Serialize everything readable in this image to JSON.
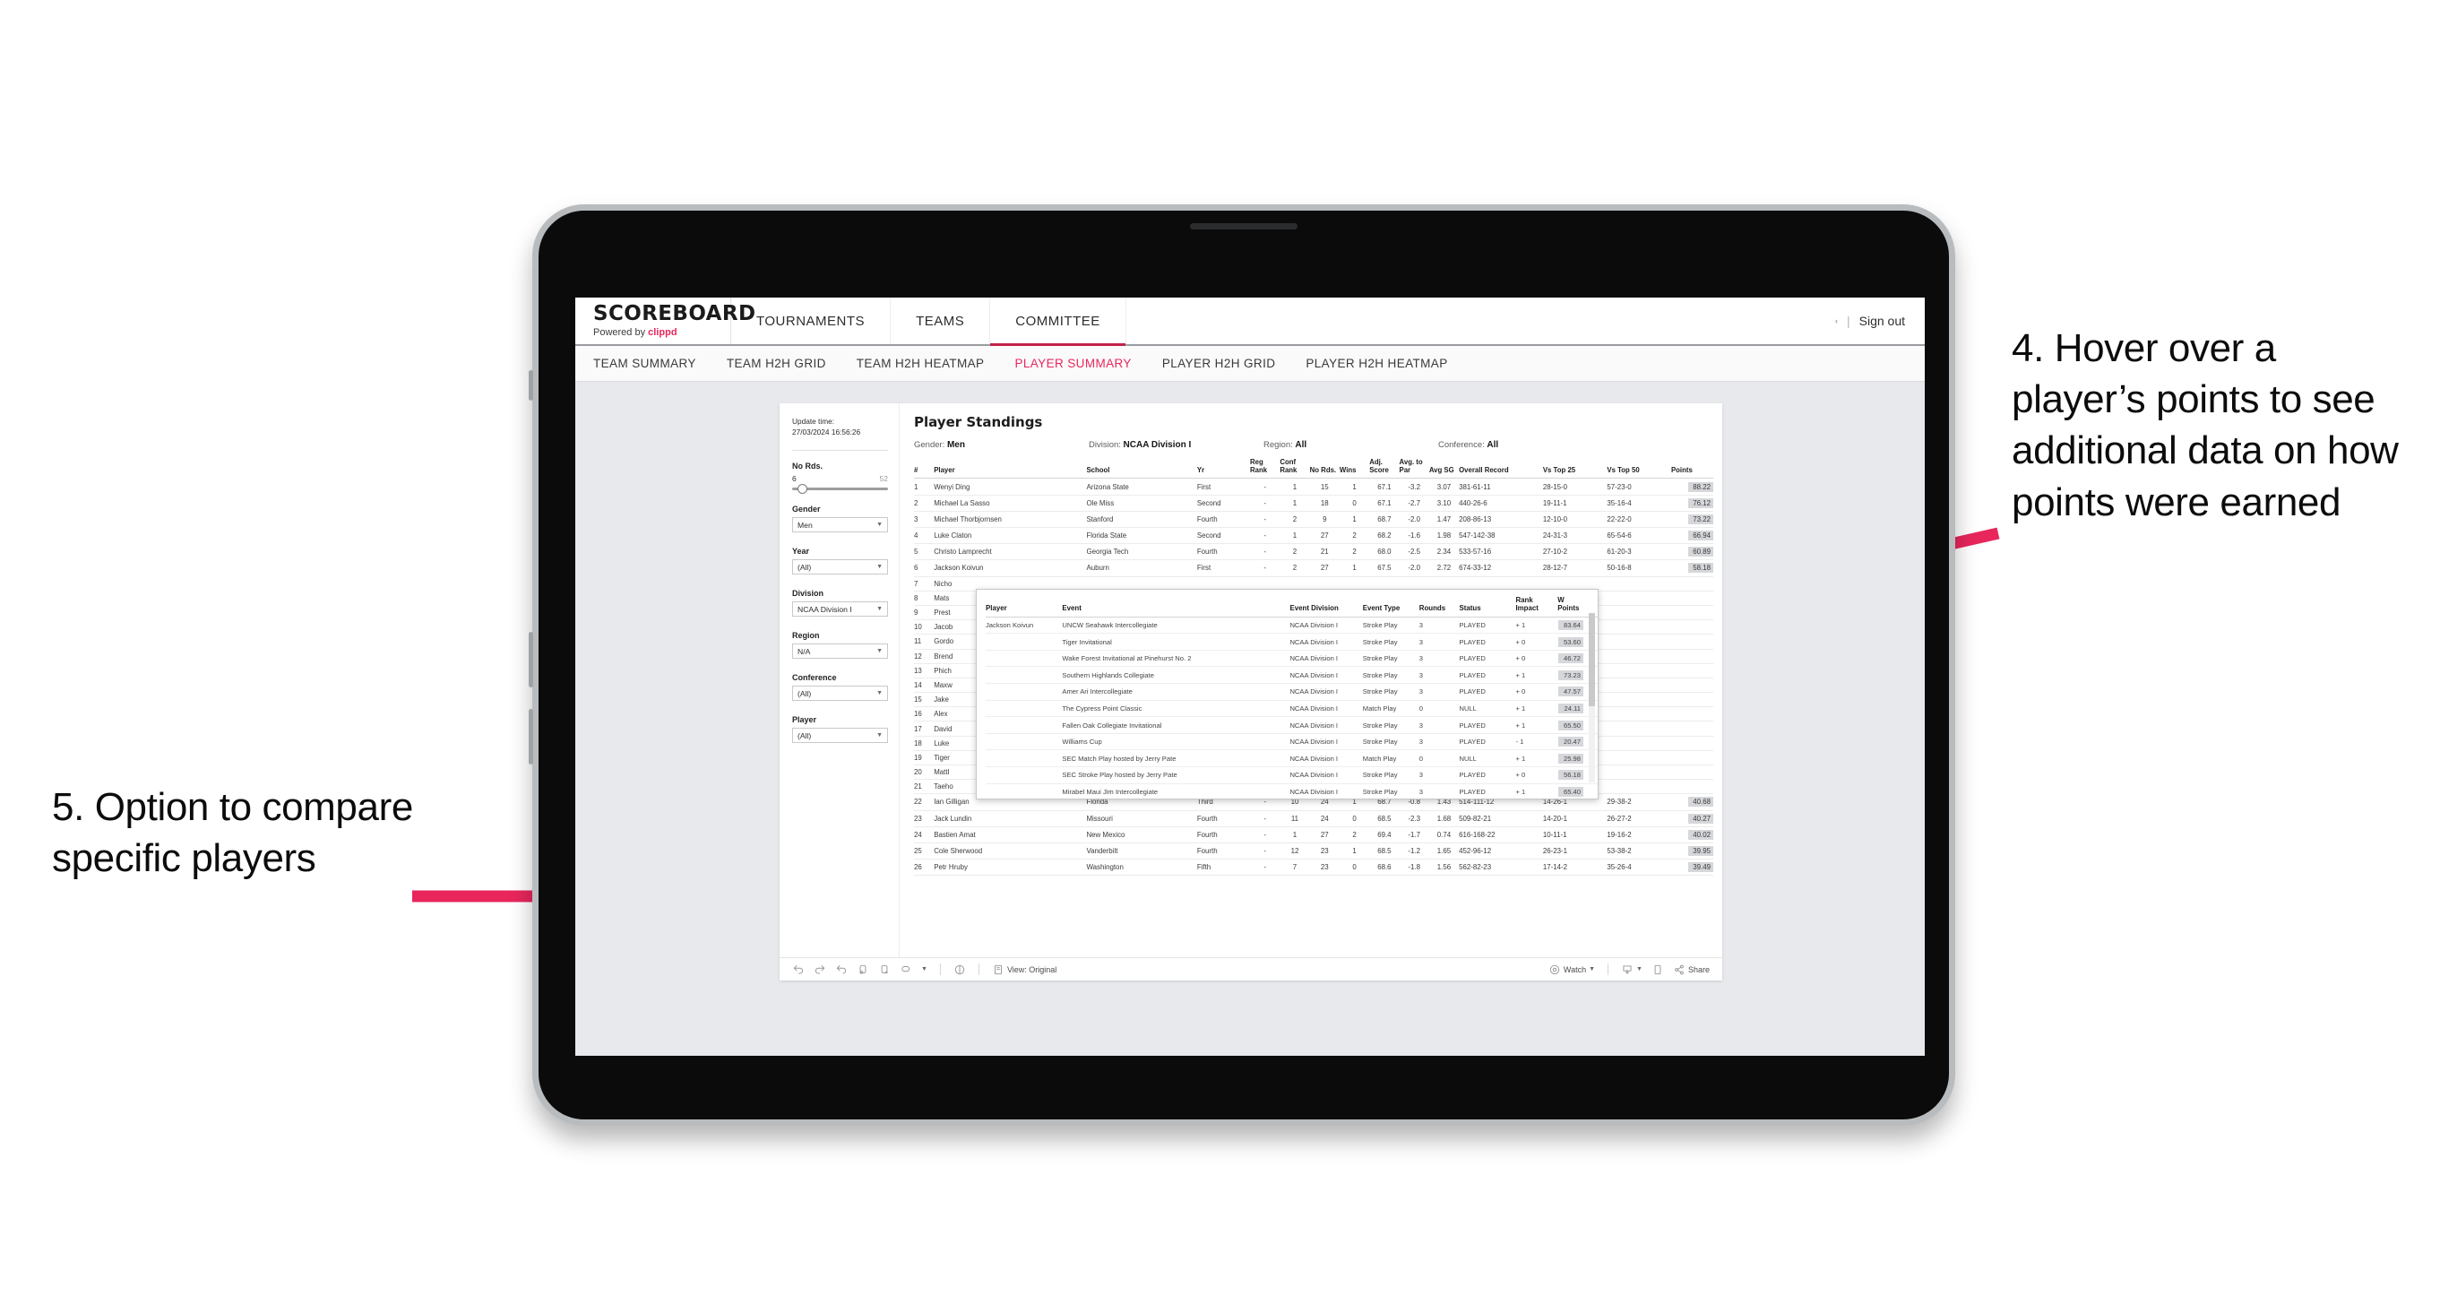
{
  "annotations": {
    "left": "5. Option to compare specific players",
    "right": "4. Hover over a player’s points to see additional data on how points were earned",
    "arrow_color": "#e8265c"
  },
  "app": {
    "brand_title": "SCOREBOARD",
    "brand_sub_prefix": "Powered by ",
    "brand_sub_accent": "clippd",
    "accent_color": "#e8265c",
    "top_nav": [
      {
        "label": "TOURNAMENTS",
        "active": false
      },
      {
        "label": "TEAMS",
        "active": false
      },
      {
        "label": "COMMITTEE",
        "active": true
      }
    ],
    "top_right": {
      "caret": "‹",
      "separator": "|",
      "sign_out": "Sign out"
    },
    "sub_nav": [
      {
        "label": "TEAM SUMMARY",
        "active": false
      },
      {
        "label": "TEAM H2H GRID",
        "active": false
      },
      {
        "label": "TEAM H2H HEATMAP",
        "active": false
      },
      {
        "label": "PLAYER SUMMARY",
        "active": true
      },
      {
        "label": "PLAYER H2H GRID",
        "active": false
      },
      {
        "label": "PLAYER H2H HEATMAP",
        "active": false
      }
    ]
  },
  "rail": {
    "update_label": "Update time:",
    "update_value": "27/03/2024 16:56:26",
    "slider": {
      "label": "No Rds.",
      "min": "6",
      "max": "52"
    },
    "filters": [
      {
        "label": "Gender",
        "value": "Men"
      },
      {
        "label": "Year",
        "value": "(All)"
      },
      {
        "label": "Division",
        "value": "NCAA Division I"
      },
      {
        "label": "Region",
        "value": "N/A"
      },
      {
        "label": "Conference",
        "value": "(All)"
      },
      {
        "label": "Player",
        "value": "(All)"
      }
    ]
  },
  "main": {
    "title": "Player Standings",
    "meta": [
      {
        "label": "Gender:",
        "value": "Men"
      },
      {
        "label": "Division:",
        "value": "NCAA Division I"
      },
      {
        "label": "Region:",
        "value": "All"
      },
      {
        "label": "Conference:",
        "value": "All"
      }
    ],
    "columns": [
      "#",
      "Player",
      "School",
      "Yr",
      "Reg Rank",
      "Conf Rank",
      "No Rds.",
      "Wins",
      "Adj. Score",
      "Avg. to Par",
      "Avg SG",
      "Overall Record",
      "Vs Top 25",
      "Vs Top 50",
      "Points"
    ],
    "rows": [
      {
        "rank": "1",
        "player": "Wenyi Ding",
        "school": "Arizona State",
        "yr": "First",
        "reg": "-",
        "conf": "1",
        "rds": "15",
        "wins": "1",
        "adj": "67.1",
        "par": "-3.2",
        "sg": "3.07",
        "rec": "381-61-11",
        "t25": "28-15-0",
        "t50": "57-23-0",
        "pts": "88.22"
      },
      {
        "rank": "2",
        "player": "Michael La Sasso",
        "school": "Ole Miss",
        "yr": "Second",
        "reg": "-",
        "conf": "1",
        "rds": "18",
        "wins": "0",
        "adj": "67.1",
        "par": "-2.7",
        "sg": "3.10",
        "rec": "440-26-6",
        "t25": "19-11-1",
        "t50": "35-16-4",
        "pts": "76.12"
      },
      {
        "rank": "3",
        "player": "Michael Thorbjornsen",
        "school": "Stanford",
        "yr": "Fourth",
        "reg": "-",
        "conf": "2",
        "rds": "9",
        "wins": "1",
        "adj": "68.7",
        "par": "-2.0",
        "sg": "1.47",
        "rec": "208-86-13",
        "t25": "12-10-0",
        "t50": "22-22-0",
        "pts": "73.22"
      },
      {
        "rank": "4",
        "player": "Luke Claton",
        "school": "Florida State",
        "yr": "Second",
        "reg": "-",
        "conf": "1",
        "rds": "27",
        "wins": "2",
        "adj": "68.2",
        "par": "-1.6",
        "sg": "1.98",
        "rec": "547-142-38",
        "t25": "24-31-3",
        "t50": "65-54-6",
        "pts": "66.94"
      },
      {
        "rank": "5",
        "player": "Christo Lamprecht",
        "school": "Georgia Tech",
        "yr": "Fourth",
        "reg": "-",
        "conf": "2",
        "rds": "21",
        "wins": "2",
        "adj": "68.0",
        "par": "-2.5",
        "sg": "2.34",
        "rec": "533-57-16",
        "t25": "27-10-2",
        "t50": "61-20-3",
        "pts": "60.89"
      },
      {
        "rank": "6",
        "player": "Jackson Koivun",
        "school": "Auburn",
        "yr": "First",
        "reg": "-",
        "conf": "2",
        "rds": "27",
        "wins": "1",
        "adj": "67.5",
        "par": "-2.0",
        "sg": "2.72",
        "rec": "674-33-12",
        "t25": "28-12-7",
        "t50": "50-16-8",
        "pts": "58.18"
      },
      {
        "rank": "7",
        "player": "Nicho",
        "school": "",
        "yr": "",
        "reg": "",
        "conf": "",
        "rds": "",
        "wins": "",
        "adj": "",
        "par": "",
        "sg": "",
        "rec": "",
        "t25": "",
        "t50": "",
        "pts": ""
      },
      {
        "rank": "8",
        "player": "Mats",
        "school": "",
        "yr": "",
        "reg": "",
        "conf": "",
        "rds": "",
        "wins": "",
        "adj": "",
        "par": "",
        "sg": "",
        "rec": "",
        "t25": "",
        "t50": "",
        "pts": ""
      },
      {
        "rank": "9",
        "player": "Prest",
        "school": "",
        "yr": "",
        "reg": "",
        "conf": "",
        "rds": "",
        "wins": "",
        "adj": "",
        "par": "",
        "sg": "",
        "rec": "",
        "t25": "",
        "t50": "",
        "pts": ""
      },
      {
        "rank": "10",
        "player": "Jacob",
        "school": "",
        "yr": "",
        "reg": "",
        "conf": "",
        "rds": "",
        "wins": "",
        "adj": "",
        "par": "",
        "sg": "",
        "rec": "",
        "t25": "",
        "t50": "",
        "pts": ""
      },
      {
        "rank": "11",
        "player": "Gordo",
        "school": "",
        "yr": "",
        "reg": "",
        "conf": "",
        "rds": "",
        "wins": "",
        "adj": "",
        "par": "",
        "sg": "",
        "rec": "",
        "t25": "",
        "t50": "",
        "pts": ""
      },
      {
        "rank": "12",
        "player": "Brend",
        "school": "",
        "yr": "",
        "reg": "",
        "conf": "",
        "rds": "",
        "wins": "",
        "adj": "",
        "par": "",
        "sg": "",
        "rec": "",
        "t25": "",
        "t50": "",
        "pts": ""
      },
      {
        "rank": "13",
        "player": "Phich",
        "school": "",
        "yr": "",
        "reg": "",
        "conf": "",
        "rds": "",
        "wins": "",
        "adj": "",
        "par": "",
        "sg": "",
        "rec": "",
        "t25": "",
        "t50": "",
        "pts": ""
      },
      {
        "rank": "14",
        "player": "Maxw",
        "school": "",
        "yr": "",
        "reg": "",
        "conf": "",
        "rds": "",
        "wins": "",
        "adj": "",
        "par": "",
        "sg": "",
        "rec": "",
        "t25": "",
        "t50": "",
        "pts": ""
      },
      {
        "rank": "15",
        "player": "Jake",
        "school": "",
        "yr": "",
        "reg": "",
        "conf": "",
        "rds": "",
        "wins": "",
        "adj": "",
        "par": "",
        "sg": "",
        "rec": "",
        "t25": "",
        "t50": "",
        "pts": ""
      },
      {
        "rank": "16",
        "player": "Alex",
        "school": "",
        "yr": "",
        "reg": "",
        "conf": "",
        "rds": "",
        "wins": "",
        "adj": "",
        "par": "",
        "sg": "",
        "rec": "",
        "t25": "",
        "t50": "",
        "pts": ""
      },
      {
        "rank": "17",
        "player": "David",
        "school": "",
        "yr": "",
        "reg": "",
        "conf": "",
        "rds": "",
        "wins": "",
        "adj": "",
        "par": "",
        "sg": "",
        "rec": "",
        "t25": "",
        "t50": "",
        "pts": ""
      },
      {
        "rank": "18",
        "player": "Luke",
        "school": "",
        "yr": "",
        "reg": "",
        "conf": "",
        "rds": "",
        "wins": "",
        "adj": "",
        "par": "",
        "sg": "",
        "rec": "",
        "t25": "",
        "t50": "",
        "pts": ""
      },
      {
        "rank": "19",
        "player": "Tiger",
        "school": "",
        "yr": "",
        "reg": "",
        "conf": "",
        "rds": "",
        "wins": "",
        "adj": "",
        "par": "",
        "sg": "",
        "rec": "",
        "t25": "",
        "t50": "",
        "pts": ""
      },
      {
        "rank": "20",
        "player": "Mattl",
        "school": "",
        "yr": "",
        "reg": "",
        "conf": "",
        "rds": "",
        "wins": "",
        "adj": "",
        "par": "",
        "sg": "",
        "rec": "",
        "t25": "",
        "t50": "",
        "pts": ""
      },
      {
        "rank": "21",
        "player": "Taeho",
        "school": "",
        "yr": "",
        "reg": "",
        "conf": "",
        "rds": "",
        "wins": "",
        "adj": "",
        "par": "",
        "sg": "",
        "rec": "",
        "t25": "",
        "t50": "",
        "pts": ""
      },
      {
        "rank": "22",
        "player": "Ian Gilligan",
        "school": "Florida",
        "yr": "Third",
        "reg": "-",
        "conf": "10",
        "rds": "24",
        "wins": "1",
        "adj": "68.7",
        "par": "-0.8",
        "sg": "1.43",
        "rec": "514-111-12",
        "t25": "14-26-1",
        "t50": "29-38-2",
        "pts": "40.68"
      },
      {
        "rank": "23",
        "player": "Jack Lundin",
        "school": "Missouri",
        "yr": "Fourth",
        "reg": "-",
        "conf": "11",
        "rds": "24",
        "wins": "0",
        "adj": "68.5",
        "par": "-2.3",
        "sg": "1.68",
        "rec": "509-82-21",
        "t25": "14-20-1",
        "t50": "26-27-2",
        "pts": "40.27"
      },
      {
        "rank": "24",
        "player": "Bastien Amat",
        "school": "New Mexico",
        "yr": "Fourth",
        "reg": "-",
        "conf": "1",
        "rds": "27",
        "wins": "2",
        "adj": "69.4",
        "par": "-1.7",
        "sg": "0.74",
        "rec": "616-168-22",
        "t25": "10-11-1",
        "t50": "19-16-2",
        "pts": "40.02"
      },
      {
        "rank": "25",
        "player": "Cole Sherwood",
        "school": "Vanderbilt",
        "yr": "Fourth",
        "reg": "-",
        "conf": "12",
        "rds": "23",
        "wins": "1",
        "adj": "68.5",
        "par": "-1.2",
        "sg": "1.65",
        "rec": "452-96-12",
        "t25": "26-23-1",
        "t50": "53-38-2",
        "pts": "39.95"
      },
      {
        "rank": "26",
        "player": "Petr Hruby",
        "school": "Washington",
        "yr": "Fifth",
        "reg": "-",
        "conf": "7",
        "rds": "23",
        "wins": "0",
        "adj": "68.6",
        "par": "-1.8",
        "sg": "1.56",
        "rec": "562-82-23",
        "t25": "17-14-2",
        "t50": "35-26-4",
        "pts": "39.49"
      }
    ]
  },
  "tooltip": {
    "columns": [
      "Player",
      "Event",
      "Event Division",
      "Event Type",
      "Rounds",
      "Status",
      "Rank Impact",
      "W Points"
    ],
    "player": "Jackson Koivun",
    "rows": [
      {
        "event": "UNCW Seahawk Intercollegiate",
        "division": "NCAA Division I",
        "type": "Stroke Play",
        "rounds": "3",
        "status": "PLAYED",
        "impact": "+ 1",
        "wpoints": "83.64"
      },
      {
        "event": "Tiger Invitational",
        "division": "NCAA Division I",
        "type": "Stroke Play",
        "rounds": "3",
        "status": "PLAYED",
        "impact": "+ 0",
        "wpoints": "53.60"
      },
      {
        "event": "Wake Forest Invitational at Pinehurst No. 2",
        "division": "NCAA Division I",
        "type": "Stroke Play",
        "rounds": "3",
        "status": "PLAYED",
        "impact": "+ 0",
        "wpoints": "46.72"
      },
      {
        "event": "Southern Highlands Collegiate",
        "division": "NCAA Division I",
        "type": "Stroke Play",
        "rounds": "3",
        "status": "PLAYED",
        "impact": "+ 1",
        "wpoints": "73.23"
      },
      {
        "event": "Amer Ari Intercollegiate",
        "division": "NCAA Division I",
        "type": "Stroke Play",
        "rounds": "3",
        "status": "PLAYED",
        "impact": "+ 0",
        "wpoints": "47.57"
      },
      {
        "event": "The Cypress Point Classic",
        "division": "NCAA Division I",
        "type": "Match Play",
        "rounds": "0",
        "status": "NULL",
        "impact": "+ 1",
        "wpoints": "24.11"
      },
      {
        "event": "Fallen Oak Collegiate Invitational",
        "division": "NCAA Division I",
        "type": "Stroke Play",
        "rounds": "3",
        "status": "PLAYED",
        "impact": "+ 1",
        "wpoints": "65.50"
      },
      {
        "event": "Williams Cup",
        "division": "NCAA Division I",
        "type": "Stroke Play",
        "rounds": "3",
        "status": "PLAYED",
        "impact": "- 1",
        "wpoints": "20.47"
      },
      {
        "event": "SEC Match Play hosted by Jerry Pate",
        "division": "NCAA Division I",
        "type": "Match Play",
        "rounds": "0",
        "status": "NULL",
        "impact": "+ 1",
        "wpoints": "25.98"
      },
      {
        "event": "SEC Stroke Play hosted by Jerry Pate",
        "division": "NCAA Division I",
        "type": "Stroke Play",
        "rounds": "3",
        "status": "PLAYED",
        "impact": "+ 0",
        "wpoints": "56.18"
      },
      {
        "event": "Mirabel Maui Jim Intercollegiate",
        "division": "NCAA Division I",
        "type": "Stroke Play",
        "rounds": "3",
        "status": "PLAYED",
        "impact": "+ 1",
        "wpoints": "65.40"
      }
    ]
  },
  "toolbar": {
    "view_label": "View: Original",
    "watch_label": "Watch",
    "share_label": "Share"
  }
}
